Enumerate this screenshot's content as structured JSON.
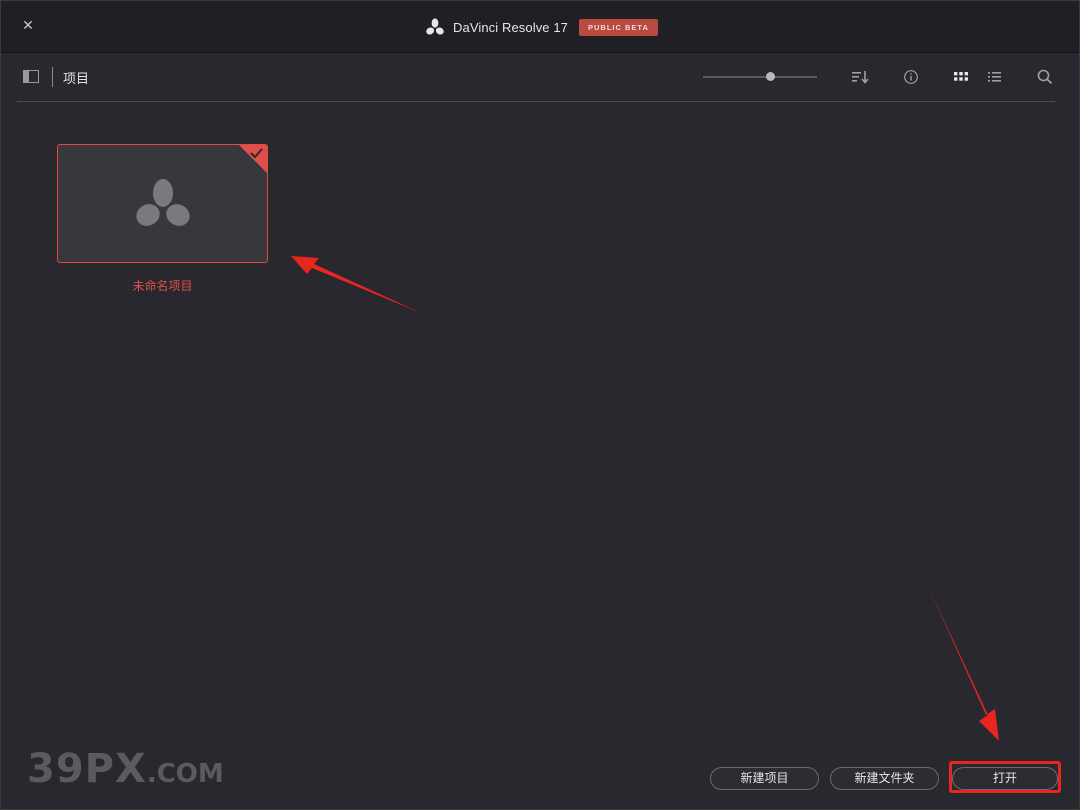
{
  "window": {
    "title": "DaVinci Resolve 17",
    "badge": "PUBLIC BETA",
    "close_symbol": "✕"
  },
  "toolbar": {
    "section_title": "项目",
    "zoom_level": 0.6,
    "icons": [
      "sidebar-toggle-icon",
      "sort-icon",
      "info-icon",
      "grid-view-icon",
      "list-view-icon",
      "search-icon"
    ]
  },
  "projects": [
    {
      "name": "未命名项目",
      "selected": true
    }
  ],
  "footer": {
    "new_project_label": "新建项目",
    "new_folder_label": "新建文件夹",
    "open_label": "打开"
  },
  "watermark": {
    "main": "39PX",
    "suffix": ".COM"
  },
  "colors": {
    "accent": "#e0504a",
    "badge": "#b84a3f",
    "highlight": "#e8251e",
    "background": "#28282e"
  }
}
